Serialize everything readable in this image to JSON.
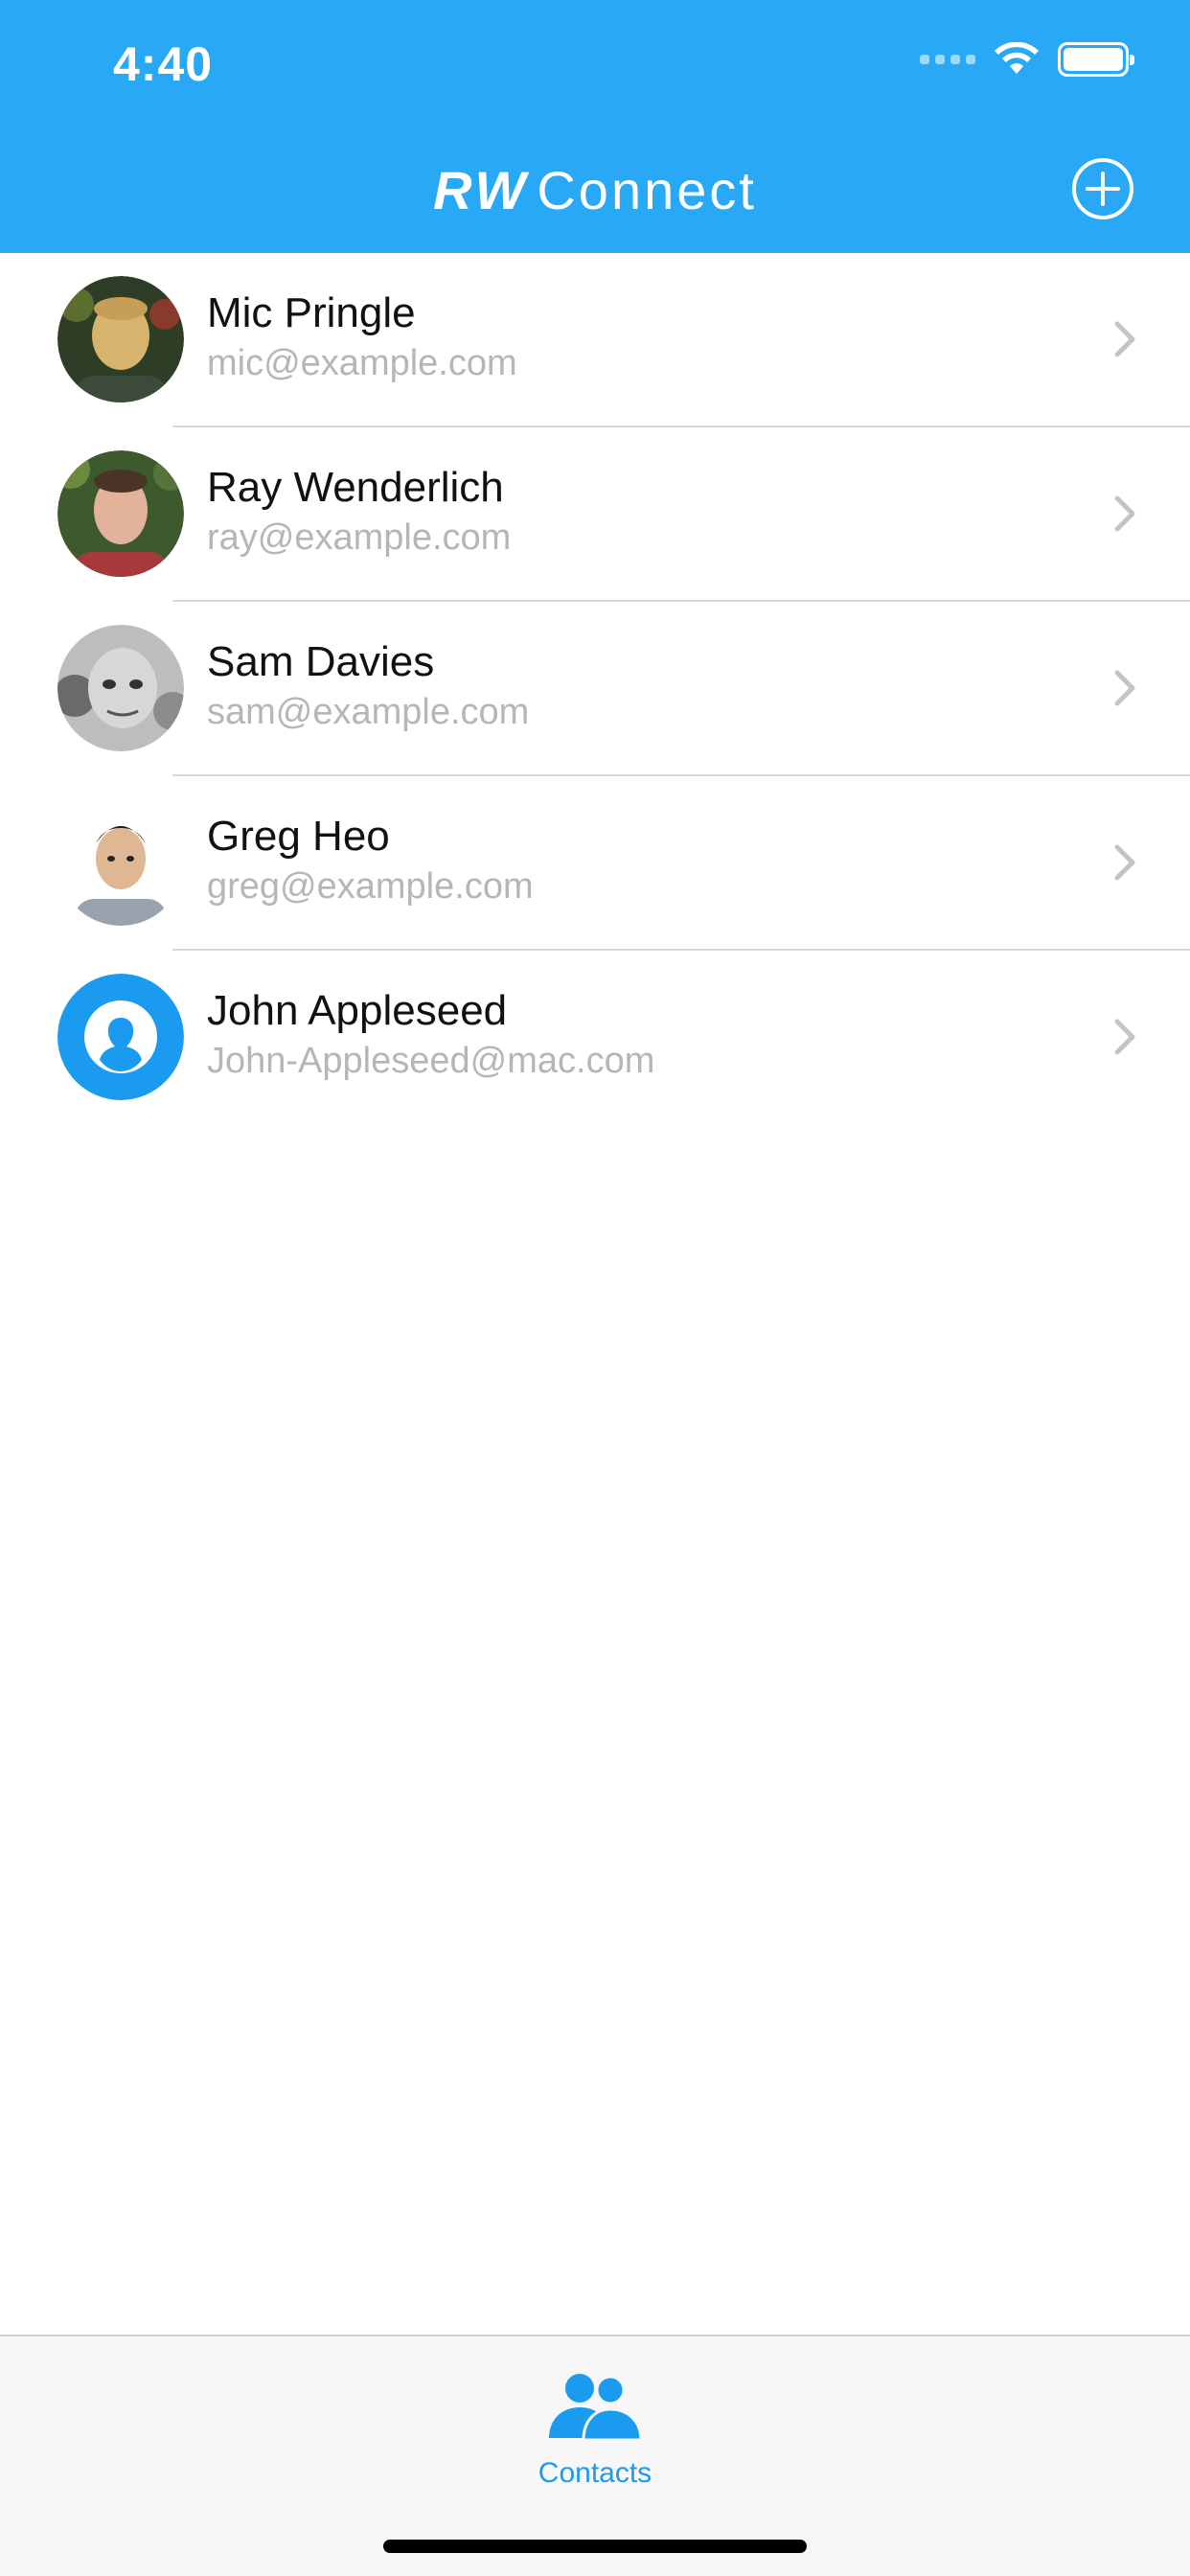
{
  "status_bar": {
    "time": "4:40"
  },
  "nav": {
    "title_brand": "RW",
    "title_text": "Connect"
  },
  "colors": {
    "header_bg": "#28a8f5",
    "accent": "#1a9bf0",
    "placeholder_avatar": "#1a9bf0"
  },
  "contacts": [
    {
      "name": "Mic Pringle",
      "email": "mic@example.com"
    },
    {
      "name": "Ray Wenderlich",
      "email": "ray@example.com"
    },
    {
      "name": "Sam Davies",
      "email": "sam@example.com"
    },
    {
      "name": "Greg Heo",
      "email": "greg@example.com"
    },
    {
      "name": "John Appleseed",
      "email": "John-Appleseed@mac.com"
    }
  ],
  "tabbar": {
    "tab_label": "Contacts",
    "tab_icon": "contacts-icon"
  }
}
